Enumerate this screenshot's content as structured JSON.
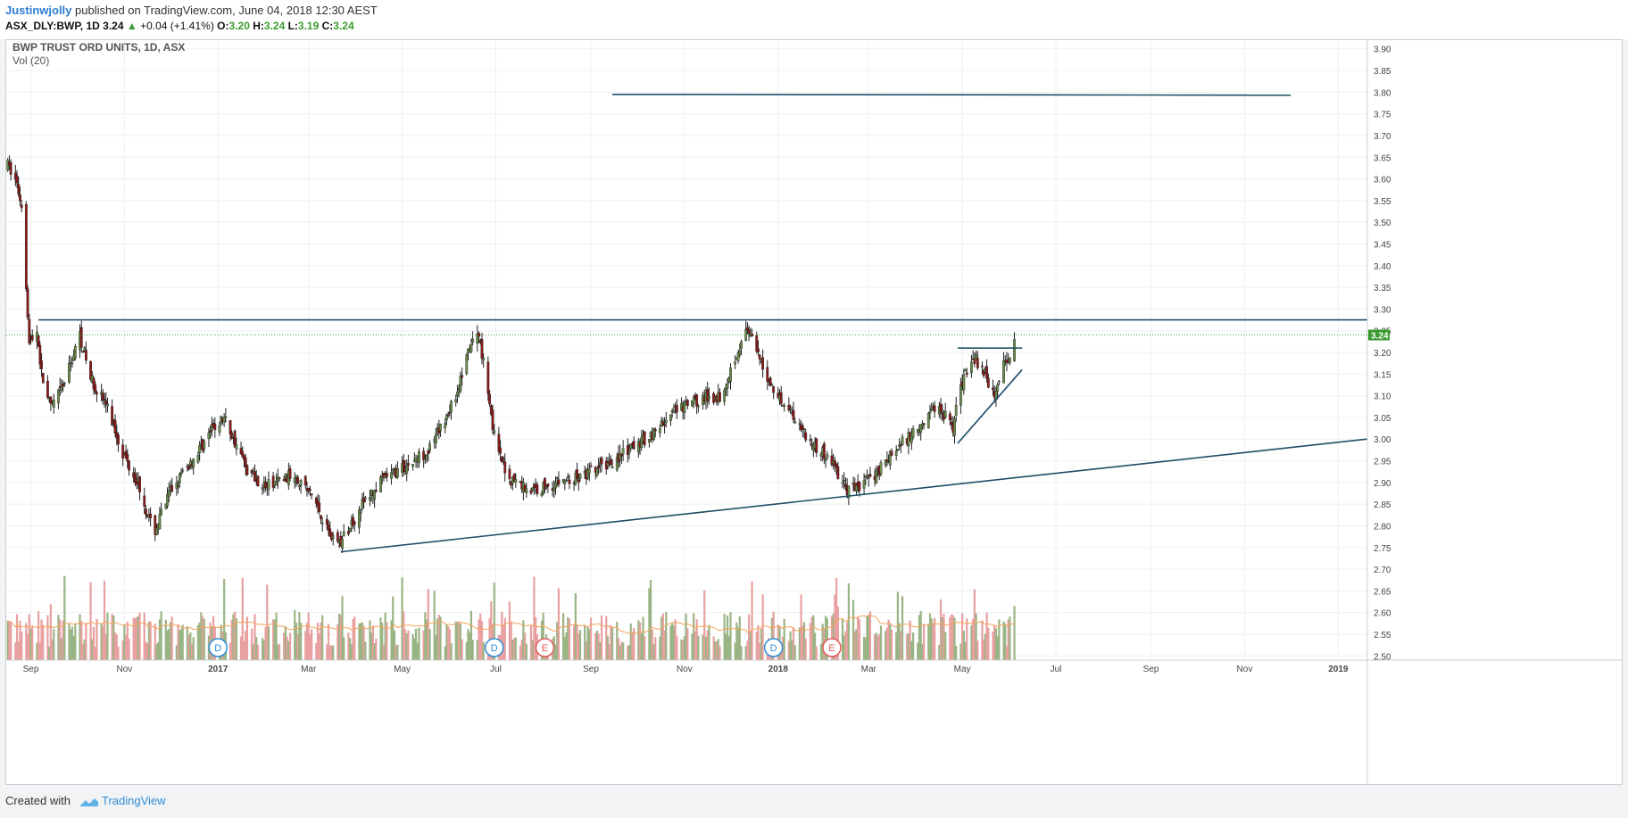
{
  "header": {
    "author": "Justinwjolly",
    "published_text": "published on TradingView.com, June 04, 2018 12:30 AEST",
    "symbol": "ASX_DLY:BWP, 1D",
    "last": "3.24",
    "change": "+0.04 (+1.41%)",
    "o_label": "O:",
    "o_value": "3.20",
    "h_label": "H:",
    "h_value": "3.24",
    "l_label": "L:",
    "l_value": "3.19",
    "c_label": "C:",
    "c_value": "3.24"
  },
  "legend": {
    "title": "BWP TRUST ORD UNITS, 1D, ASX",
    "indicator": "Vol (20)"
  },
  "footer": {
    "created_with": "Created with",
    "brand": "TradingView"
  },
  "colors": {
    "up": "#6b8f4e",
    "down": "#8b1a1a",
    "vol_up": "#9ab585",
    "vol_down": "#e8a0a0",
    "trendline": "#1f4e66",
    "ma": "#f5a55a",
    "price_tag": "#3a9a2f",
    "event_d": "#2f8dd8",
    "event_e": "#e05a5a"
  },
  "chart_data": {
    "type": "candlestick",
    "title": "BWP TRUST ORD UNITS, 1D, ASX",
    "ylim": [
      2.48,
      3.92
    ],
    "y_ticks": [
      "3.90",
      "3.85",
      "3.80",
      "3.75",
      "3.70",
      "3.65",
      "3.60",
      "3.55",
      "3.50",
      "3.45",
      "3.40",
      "3.35",
      "3.30",
      "3.25",
      "3.20",
      "3.15",
      "3.10",
      "3.05",
      "3.00",
      "2.95",
      "2.90",
      "2.85",
      "2.80",
      "2.75",
      "2.70",
      "2.65",
      "2.60",
      "2.55",
      "2.50"
    ],
    "x_ticks": [
      "Sep",
      "Nov",
      "2017",
      "Mar",
      "May",
      "Jul",
      "Sep",
      "Nov",
      "2018",
      "Mar",
      "May",
      "Jul",
      "Sep",
      "Nov",
      "2019"
    ],
    "x_tick_dates": [
      "2016-09-01",
      "2016-11-01",
      "2017-01-01",
      "2017-03-01",
      "2017-05-01",
      "2017-07-01",
      "2017-09-01",
      "2017-11-01",
      "2018-01-01",
      "2018-03-01",
      "2018-05-01",
      "2018-07-01",
      "2018-09-01",
      "2018-11-01",
      "2019-01-01"
    ],
    "x_range": [
      "2016-08-16",
      "2019-01-20"
    ],
    "last_price": "3.24",
    "price_anchors": [
      [
        "2016-08-17",
        3.63
      ],
      [
        "2016-08-22",
        3.6
      ],
      [
        "2016-08-26",
        3.54
      ],
      [
        "2016-08-29",
        3.36
      ],
      [
        "2016-08-31",
        3.22
      ],
      [
        "2016-09-05",
        3.25
      ],
      [
        "2016-09-08",
        3.15
      ],
      [
        "2016-09-14",
        3.07
      ],
      [
        "2016-09-22",
        3.12
      ],
      [
        "2016-10-03",
        3.24
      ],
      [
        "2016-10-10",
        3.14
      ],
      [
        "2016-10-20",
        3.08
      ],
      [
        "2016-11-01",
        2.96
      ],
      [
        "2016-11-10",
        2.9
      ],
      [
        "2016-11-20",
        2.78
      ],
      [
        "2016-12-01",
        2.88
      ],
      [
        "2016-12-15",
        2.95
      ],
      [
        "2016-12-28",
        3.02
      ],
      [
        "2017-01-05",
        3.05
      ],
      [
        "2017-01-20",
        2.93
      ],
      [
        "2017-02-01",
        2.89
      ],
      [
        "2017-02-20",
        2.92
      ],
      [
        "2017-03-05",
        2.86
      ],
      [
        "2017-03-15",
        2.78
      ],
      [
        "2017-03-22",
        2.76
      ],
      [
        "2017-04-05",
        2.85
      ],
      [
        "2017-04-20",
        2.91
      ],
      [
        "2017-05-05",
        2.94
      ],
      [
        "2017-05-20",
        2.98
      ],
      [
        "2017-06-05",
        3.1
      ],
      [
        "2017-06-15",
        3.22
      ],
      [
        "2017-06-20",
        3.24
      ],
      [
        "2017-06-25",
        3.14
      ],
      [
        "2017-07-01",
        2.98
      ],
      [
        "2017-07-10",
        2.91
      ],
      [
        "2017-07-25",
        2.88
      ],
      [
        "2017-08-10",
        2.9
      ],
      [
        "2017-08-25",
        2.91
      ],
      [
        "2017-09-10",
        2.94
      ],
      [
        "2017-09-25",
        2.97
      ],
      [
        "2017-10-10",
        3.01
      ],
      [
        "2017-10-25",
        3.06
      ],
      [
        "2017-11-10",
        3.09
      ],
      [
        "2017-11-25",
        3.1
      ],
      [
        "2017-12-05",
        3.2
      ],
      [
        "2017-12-12",
        3.25
      ],
      [
        "2017-12-20",
        3.18
      ],
      [
        "2017-12-28",
        3.12
      ],
      [
        "2018-01-10",
        3.06
      ],
      [
        "2018-01-25",
        2.98
      ],
      [
        "2018-02-05",
        2.95
      ],
      [
        "2018-02-15",
        2.88
      ],
      [
        "2018-02-22",
        2.89
      ],
      [
        "2018-03-05",
        2.92
      ],
      [
        "2018-03-20",
        2.98
      ],
      [
        "2018-04-05",
        3.04
      ],
      [
        "2018-04-15",
        3.08
      ],
      [
        "2018-04-25",
        3.03
      ],
      [
        "2018-05-02",
        3.15
      ],
      [
        "2018-05-08",
        3.19
      ],
      [
        "2018-05-15",
        3.16
      ],
      [
        "2018-05-22",
        3.1
      ],
      [
        "2018-05-28",
        3.17
      ],
      [
        "2018-06-01",
        3.2
      ],
      [
        "2018-06-04",
        3.24
      ]
    ],
    "trendlines": [
      {
        "from": [
          "2016-09-06",
          3.275
        ],
        "to": [
          "2019-01-20",
          3.275
        ]
      },
      {
        "from": [
          "2017-09-15",
          3.795
        ],
        "to": [
          "2018-12-01",
          3.793
        ]
      },
      {
        "from": [
          "2017-03-22",
          2.74
        ],
        "to": [
          "2019-01-20",
          3.0
        ]
      },
      {
        "from": [
          "2018-04-28",
          2.99
        ],
        "to": [
          "2018-06-09",
          3.16
        ]
      },
      {
        "from": [
          "2018-04-28",
          3.21
        ],
        "to": [
          "2018-06-09",
          3.21
        ]
      }
    ],
    "events": [
      {
        "type": "D",
        "label": "D",
        "date": "2017-01-01"
      },
      {
        "type": "D",
        "label": "D",
        "date": "2017-06-30"
      },
      {
        "type": "E",
        "label": "E",
        "date": "2017-08-02"
      },
      {
        "type": "D",
        "label": "D",
        "date": "2017-12-29"
      },
      {
        "type": "E",
        "label": "E",
        "date": "2018-02-05"
      }
    ]
  }
}
